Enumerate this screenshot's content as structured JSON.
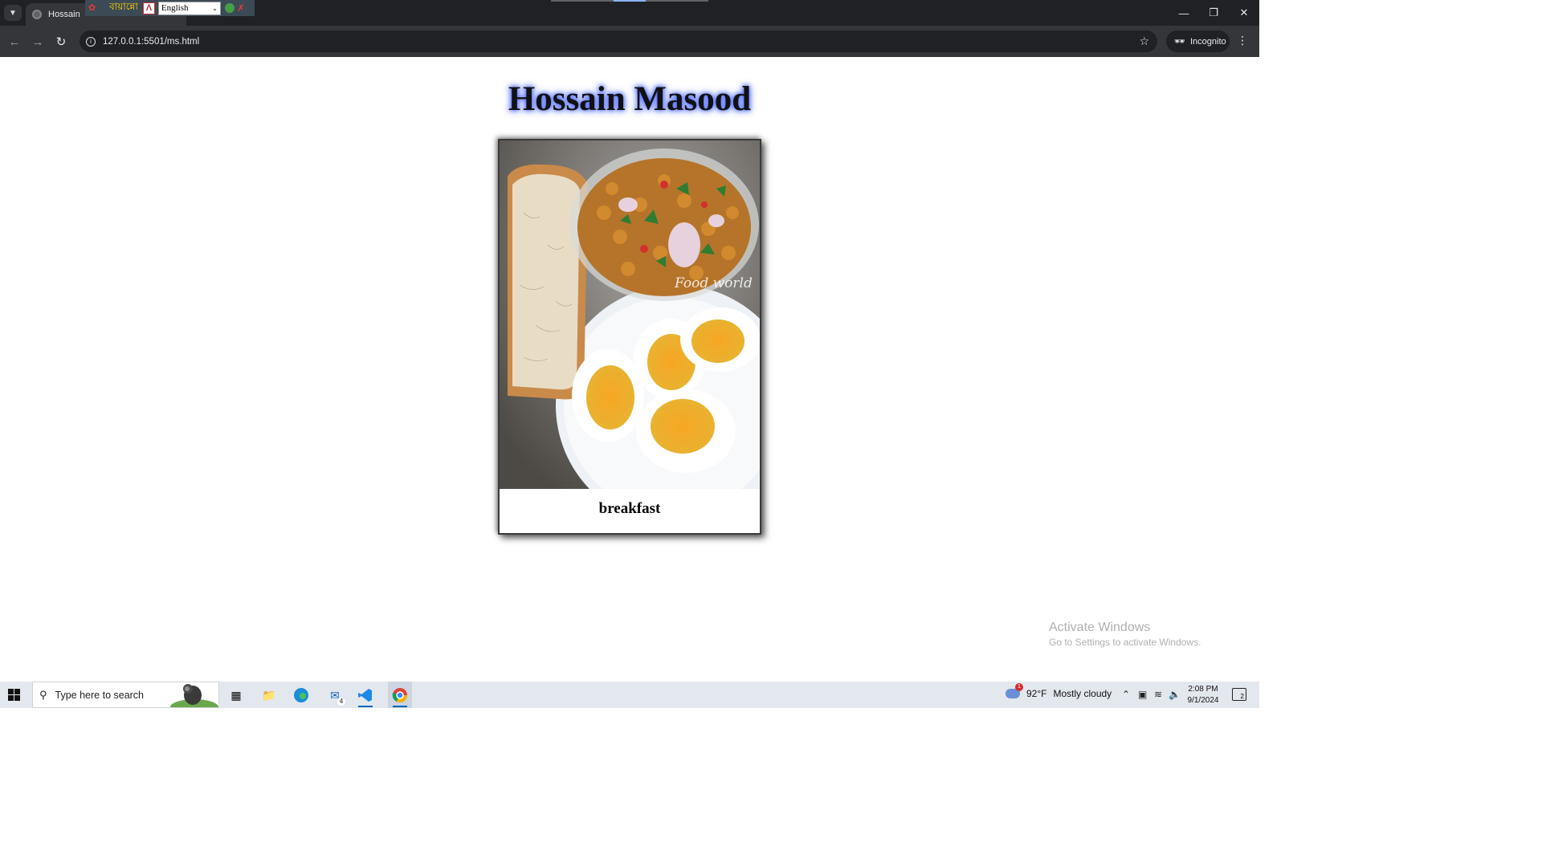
{
  "browser": {
    "tab_title": "Hossain",
    "url": "127.0.0.1:5501/ms.html",
    "incognito_label": "Incognito"
  },
  "ime_bar": {
    "bangla_label": "বায়ান্নো",
    "language_selected": "English"
  },
  "page": {
    "heading": "Hossain Masood",
    "card_caption": "breakfast",
    "photo_watermark": "Food world"
  },
  "windows_watermark": {
    "line1": "Activate Windows",
    "line2": "Go to Settings to activate Windows."
  },
  "taskbar": {
    "search_placeholder": "Type here to search",
    "mail_badge": "4",
    "weather_temp": "92°F",
    "weather_text": "Mostly cloudy",
    "weather_alert": "1",
    "time": "2:08 PM",
    "date": "9/1/2024",
    "notification_count": "2"
  },
  "colors": {
    "title_glow": "#3b5bff",
    "chrome_dark": "#202124",
    "taskbar_bg": "#e3e7ee"
  }
}
